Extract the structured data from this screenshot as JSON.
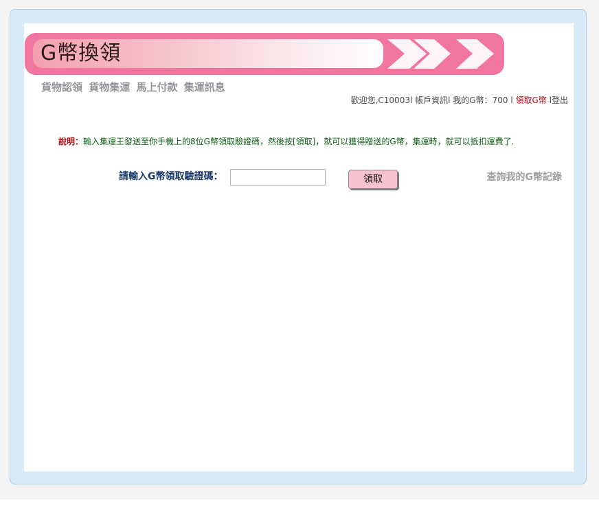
{
  "banner": {
    "title": "G幣換領"
  },
  "nav": {
    "items": [
      "貨物認領",
      "貨物集運",
      "馬上付款",
      "集運訊息"
    ]
  },
  "userbar": {
    "welcome": "歡迎您,C10003l",
    "account": "帳戶資訊l",
    "balance": "我的G幣：700",
    "sep": "l",
    "claim_link": "領取G幣",
    "logout": "l登出"
  },
  "description": {
    "label": "說明：",
    "text": "輸入集運王發送至你手機上的8位G幣領取驗證碼，然後按[領取]，就可以獲得贈送的G幣，集運時，就可以抵扣運費了."
  },
  "form": {
    "label": "請輸入G幣領取驗證碼：",
    "input_value": "",
    "submit_label": "領取",
    "record_link": "查詢我的G幣記錄"
  },
  "colors": {
    "frame_bg": "#d8eaf6",
    "banner_pink": "#f0769f",
    "accent_red": "#b00f14",
    "desc_green": "#0f5e17"
  }
}
